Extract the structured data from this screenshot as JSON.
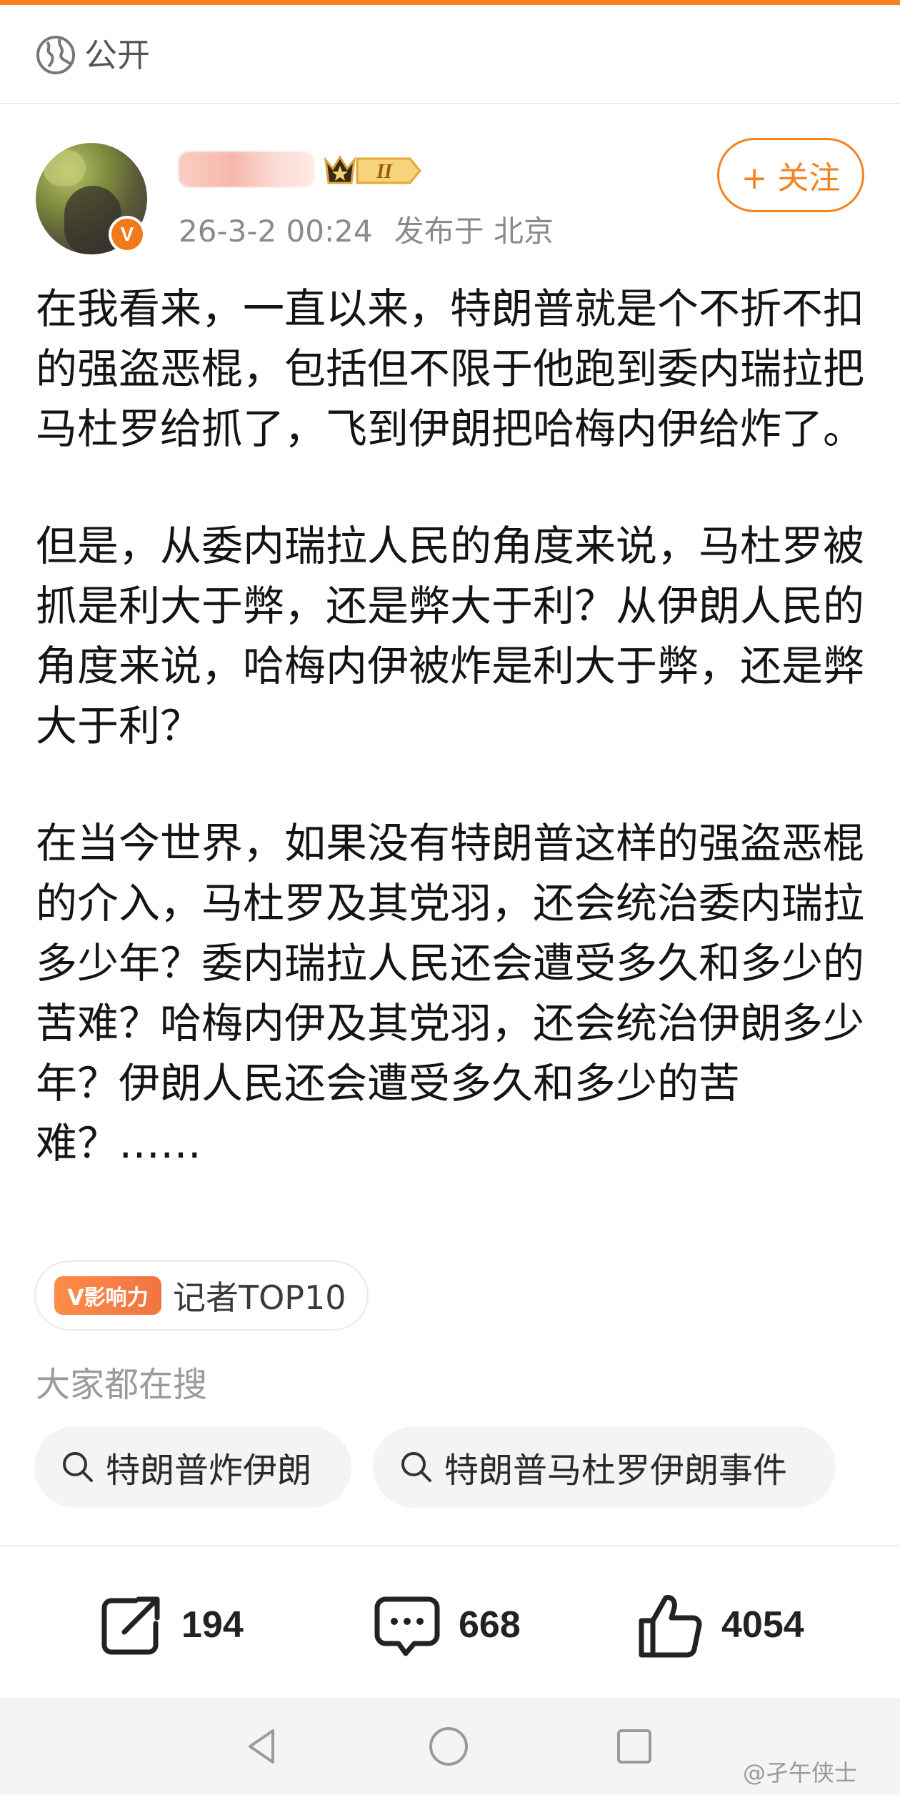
{
  "header": {
    "visibility": "公开"
  },
  "author": {
    "post_time": "26-3-2 00:24",
    "location": "发布于 北京",
    "follow_label": "+ 关注",
    "vip_mark": "V",
    "level_mark": "II"
  },
  "post": {
    "paragraphs": [
      "在我看来，一直以来，特朗普就是个不折不扣的强盗恶棍，包括但不限于他跑到委内瑞拉把马杜罗给抓了，飞到伊朗把哈梅内伊给炸了。",
      "但是，从委内瑞拉人民的角度来说，马杜罗被抓是利大于弊，还是弊大于利？从伊朗人民的角度来说，哈梅内伊被炸是利大于弊，还是弊大于利？",
      "在当今世界，如果没有特朗普这样的强盗恶棍的介入，马杜罗及其党羽，还会统治委内瑞拉多少年？委内瑞拉人民还会遭受多久和多少的苦难？哈梅内伊及其党羽，还会统治伊朗多少年？伊朗人民还会遭受多久和多少的苦难？……"
    ]
  },
  "influence": {
    "badge": "V影响力",
    "label": "记者TOP10"
  },
  "search": {
    "title": "大家都在搜",
    "chips": [
      "特朗普炸伊朗",
      "特朗普马杜罗伊朗事件"
    ]
  },
  "actions": {
    "reposts": "194",
    "comments": "668",
    "likes": "4054"
  },
  "watermark": "@孑午侠士",
  "colors": {
    "accent": "#f5821f",
    "text": "#141414",
    "muted": "#8a8a8a"
  }
}
